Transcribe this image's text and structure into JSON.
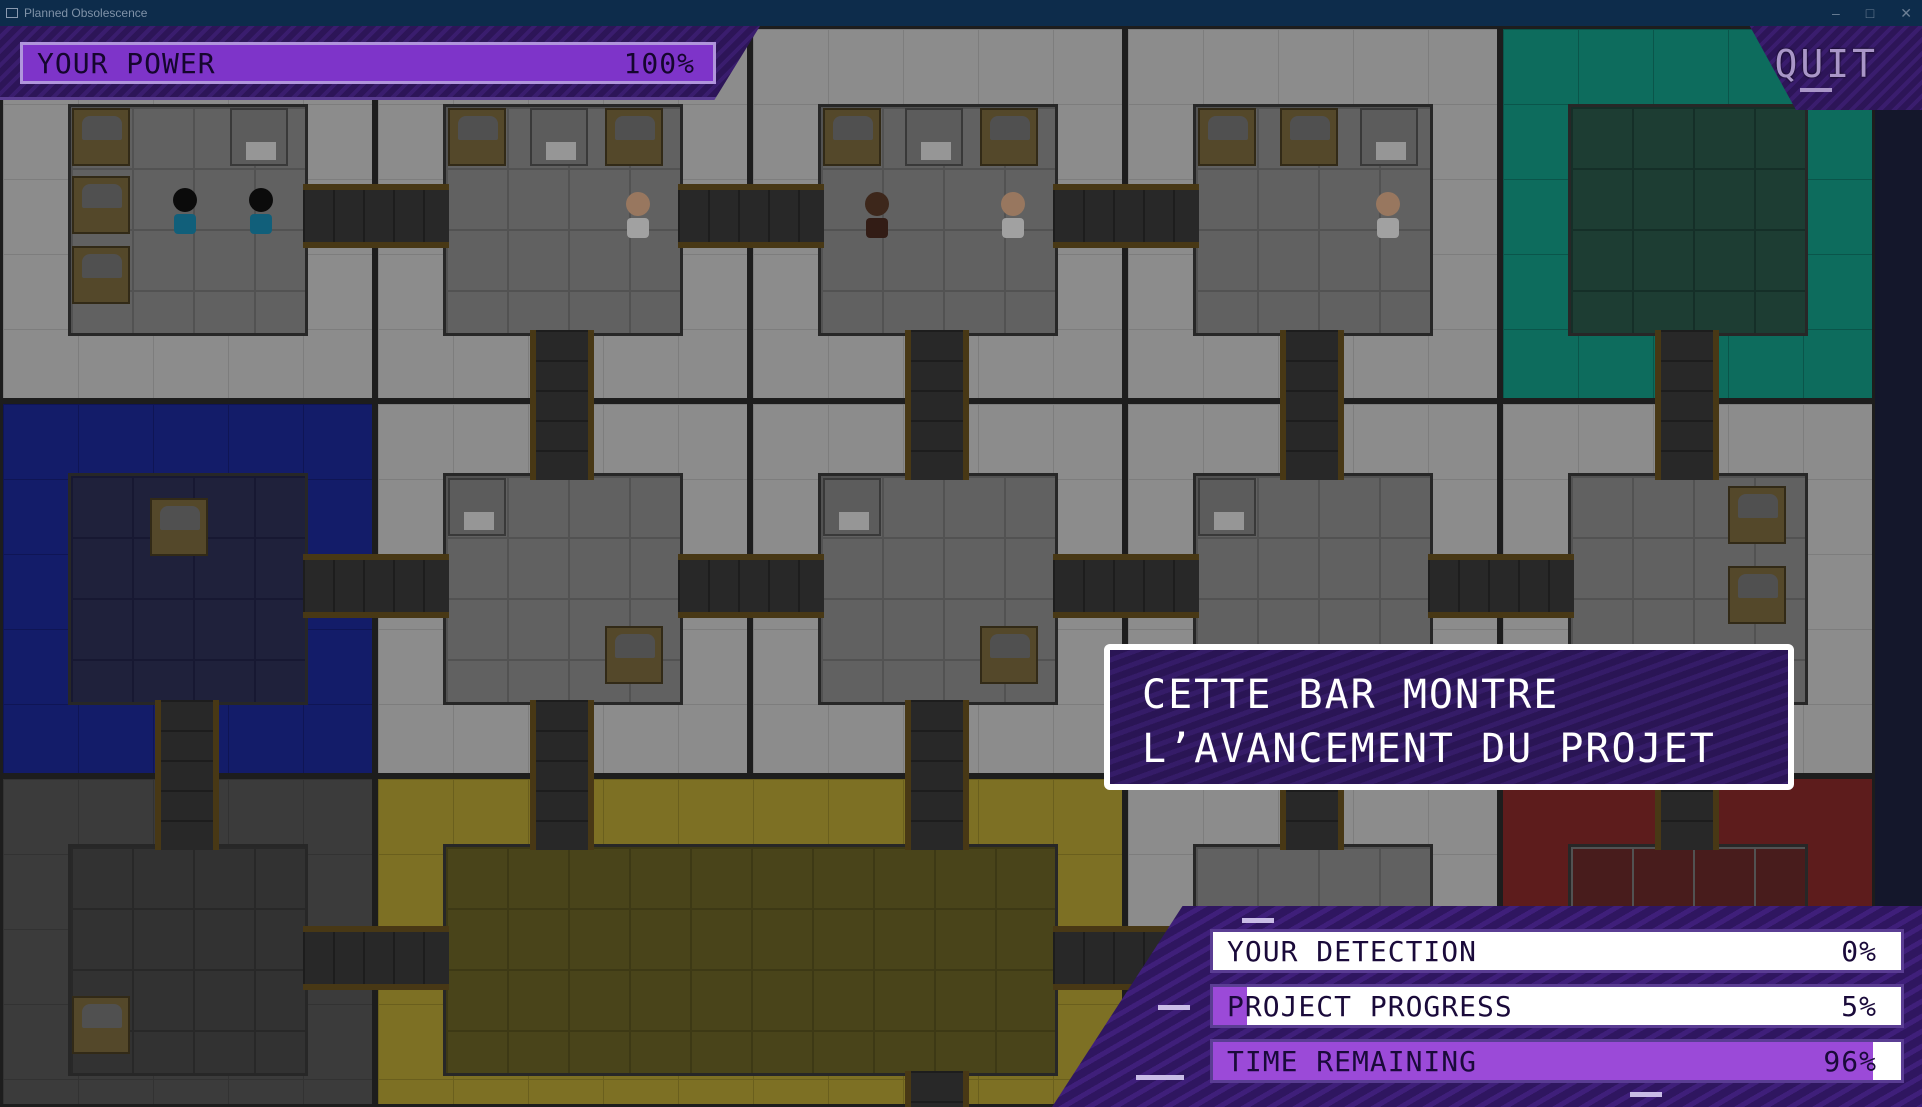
{
  "window": {
    "title": "Planned Obsolescence",
    "controls": [
      "–",
      "□",
      "✕"
    ]
  },
  "hud": {
    "power": {
      "label": "YOUR POWER",
      "value_text": "100%",
      "fraction": 1.0
    },
    "quit_label": "QUIT",
    "tooltip_lines": [
      "CETTE BAR MONTRE",
      "L’AVANCEMENT DU PROJET"
    ],
    "status": [
      {
        "label": "YOUR DETECTION",
        "value_text": "0%",
        "fraction": 0.0
      },
      {
        "label": "PROJECT PROGRESS",
        "value_text": "5%",
        "fraction": 0.05
      },
      {
        "label": "TIME REMAINING",
        "value_text": "96%",
        "fraction": 0.96
      }
    ]
  },
  "colors": {
    "hud_purple": "#3a1d6e",
    "bar_fill": "#9b4ad8",
    "power_fill": "#7e34c9",
    "room_blue": "#1d2a9b",
    "room_teal": "#14a08a",
    "room_yellow": "#b9a635",
    "room_red": "#8a2a2a"
  }
}
